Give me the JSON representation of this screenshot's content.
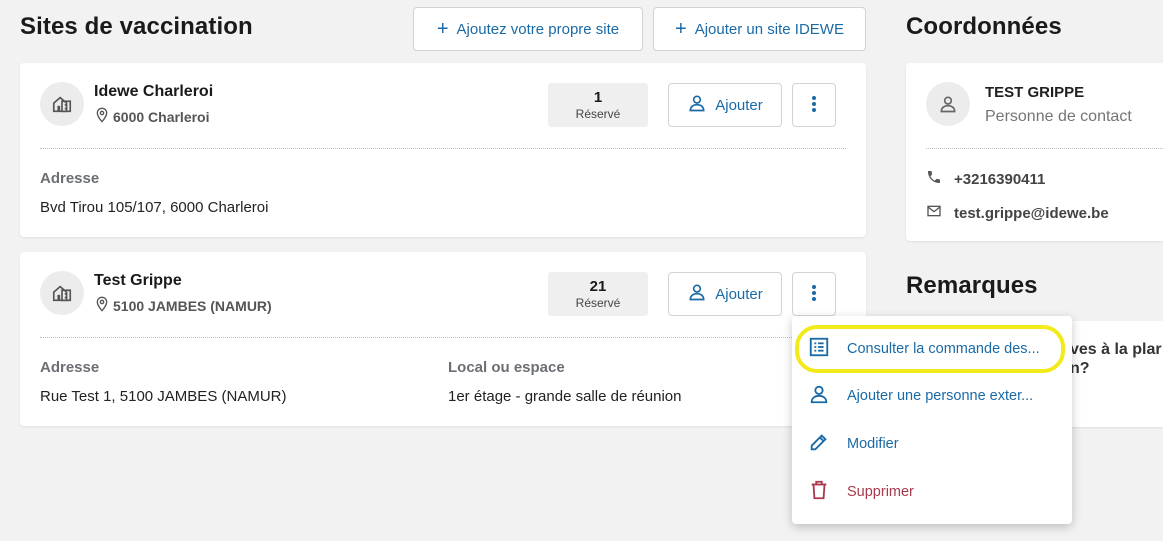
{
  "sites_section": {
    "title": "Sites de vaccination",
    "add_own_site_label": "Ajoutez votre propre site",
    "add_idewe_site_label": "Ajouter un site IDEWE"
  },
  "sites": [
    {
      "name": "Idewe Charleroi",
      "city": "6000 Charleroi",
      "count": "1",
      "count_label": "Réservé",
      "add_label": "Ajouter",
      "address_label": "Adresse",
      "address": "Bvd Tirou 105/107, 6000 Charleroi"
    },
    {
      "name": "Test Grippe",
      "city": "5100 JAMBES (NAMUR)",
      "count": "21",
      "count_label": "Réservé",
      "add_label": "Ajouter",
      "address_label": "Adresse",
      "address": "Rue Test 1, 5100 JAMBES (NAMUR)",
      "room_label": "Local ou espace",
      "room": "1er étage - grande salle de réunion"
    }
  ],
  "contact_section": {
    "title": "Coordonnées",
    "name": "TEST GRIPPE",
    "role": "Personne de contact",
    "phone": "+3216390411",
    "email": "test.grippe@idewe.be"
  },
  "remarks_section": {
    "title": "Remarques",
    "text_line1": "ves à la plar",
    "text_line2": "n?"
  },
  "context_menu": {
    "items": [
      {
        "label": "Consulter la commande des...",
        "icon": "list-icon"
      },
      {
        "label": "Ajouter une personne exter...",
        "icon": "person-icon"
      },
      {
        "label": "Modifier",
        "icon": "pencil-icon"
      },
      {
        "label": "Supprimer",
        "icon": "trash-icon"
      }
    ]
  },
  "colors": {
    "accent": "#1a6aa6",
    "danger": "#a83a4e",
    "highlight": "#f2ea1a",
    "background": "#f2f2f2"
  }
}
